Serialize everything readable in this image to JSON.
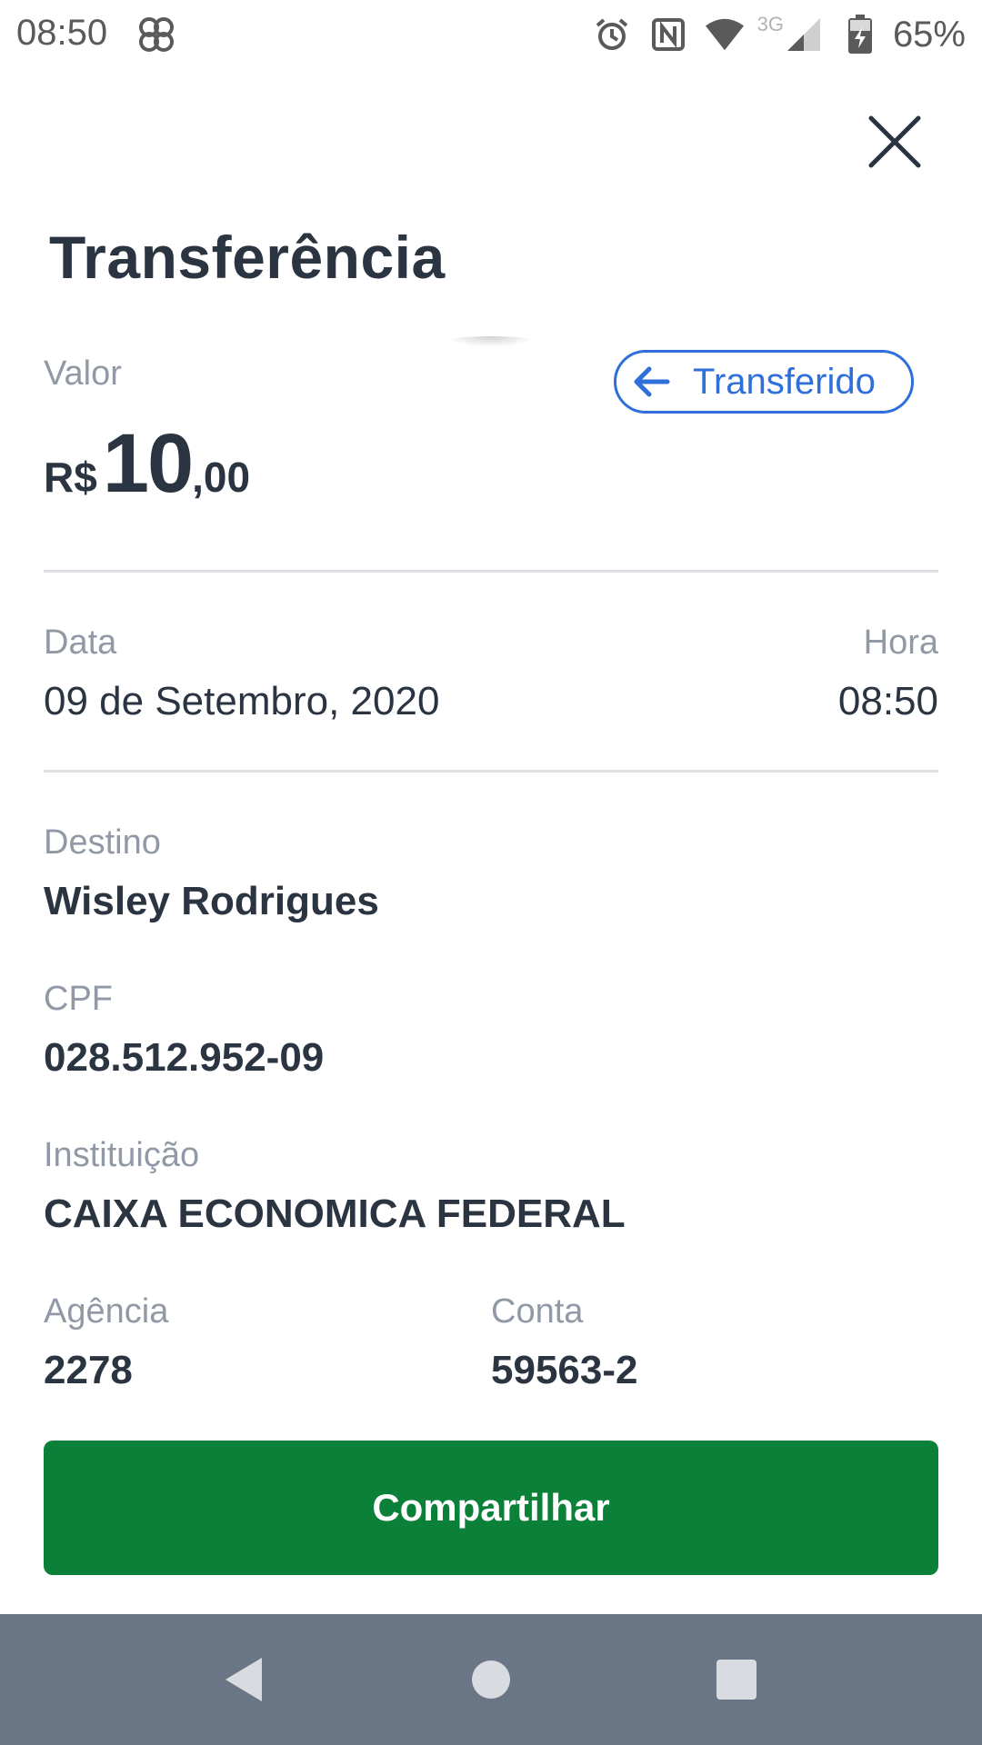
{
  "status_bar": {
    "time": "08:50",
    "network_type": "3G",
    "battery_percent": "65%",
    "icons": [
      "pinwheel-icon",
      "alarm-icon",
      "nfc-icon",
      "wifi-icon",
      "signal-icon",
      "battery-charging-icon"
    ]
  },
  "header": {
    "title": "Transferência"
  },
  "amount": {
    "label": "Valor",
    "currency": "R$",
    "integer": "10",
    "decimal": ",00"
  },
  "status_pill": {
    "label": "Transferido",
    "icon": "arrow-left-icon"
  },
  "date_time": {
    "date_label": "Data",
    "date_value": "09 de Setembro, 2020",
    "time_label": "Hora",
    "time_value": "08:50"
  },
  "recipient": {
    "destino_label": "Destino",
    "destino_value": "Wisley Rodrigues",
    "cpf_label": "CPF",
    "cpf_value": "028.512.952-09",
    "instituicao_label": "Instituição",
    "instituicao_value": "CAIXA ECONOMICA FEDERAL",
    "agencia_label": "Agência",
    "agencia_value": "2278",
    "conta_label": "Conta",
    "conta_value": "59563-2"
  },
  "actions": {
    "share_label": "Compartilhar"
  },
  "colors": {
    "primary_text": "#2b3441",
    "muted_text": "#9199a6",
    "accent_blue": "#2f6fd9",
    "button_green": "#0a8038",
    "nav_bar": "#6a7685"
  }
}
